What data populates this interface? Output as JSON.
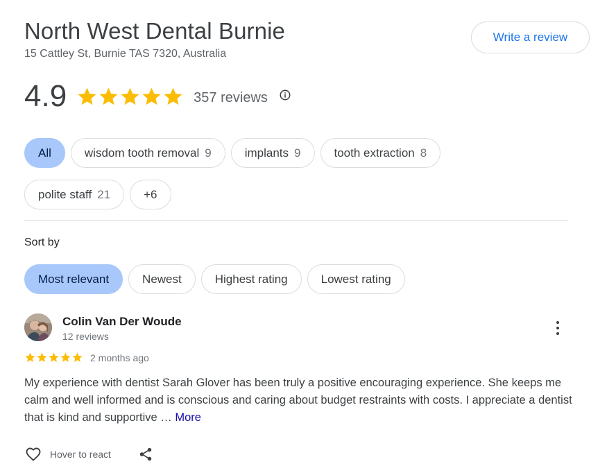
{
  "business": {
    "name": "North West Dental Burnie",
    "address": "15 Cattley St, Burnie TAS 7320, Australia",
    "write_review_label": "Write a review"
  },
  "rating": {
    "value": "4.9",
    "stars": 5,
    "review_count": "357 reviews",
    "info_icon": "info-icon"
  },
  "topic_chips": [
    {
      "label": "All",
      "count": "",
      "selected": true
    },
    {
      "label": "wisdom tooth removal",
      "count": "9",
      "selected": false
    },
    {
      "label": "implants",
      "count": "9",
      "selected": false
    },
    {
      "label": "tooth extraction",
      "count": "8",
      "selected": false
    },
    {
      "label": "polite staff",
      "count": "21",
      "selected": false
    },
    {
      "label": "+6",
      "count": "",
      "selected": false
    }
  ],
  "sort": {
    "label": "Sort by",
    "options": [
      {
        "label": "Most relevant",
        "selected": true
      },
      {
        "label": "Newest",
        "selected": false
      },
      {
        "label": "Highest rating",
        "selected": false
      },
      {
        "label": "Lowest rating",
        "selected": false
      }
    ]
  },
  "review": {
    "author": "Colin Van Der Woude",
    "author_reviews": "12 reviews",
    "stars": 5,
    "time": "2 months ago",
    "text": "My experience with dentist Sarah Glover has been truly a positive encouraging experience. She keeps me calm and well informed and is conscious and caring about budget restraints with costs. I appreciate a dentist that is kind and supportive …",
    "more_label": "More",
    "react_label": "Hover to react"
  },
  "colors": {
    "star": "#fbbc04",
    "accent": "#1a73e8",
    "chip_selected": "#a8c7fa"
  }
}
